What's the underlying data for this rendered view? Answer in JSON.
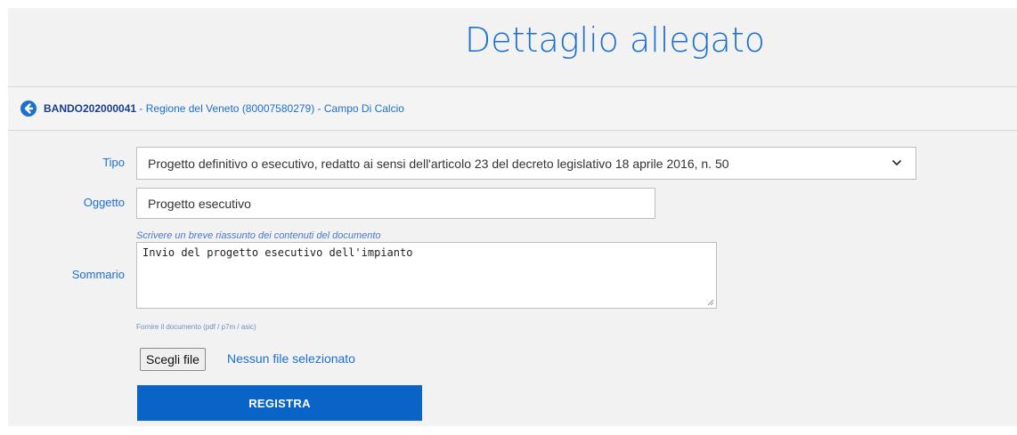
{
  "page": {
    "title": "Dettaglio allegato"
  },
  "breadcrumb": {
    "code": "BANDO202000041",
    "rest": " - Regione del Veneto (80007580279) - Campo Di Calcio"
  },
  "form": {
    "tipo_label": "Tipo",
    "tipo_value": "Progetto definitivo o esecutivo, redatto ai sensi dell'articolo 23 del decreto legislativo 18 aprile 2016, n. 50",
    "oggetto_label": "Oggetto",
    "oggetto_value": "Progetto esecutivo",
    "sommario_hint": "Scrivere un breve riassunto dei contenuti del documento",
    "sommario_label": "Sommario",
    "sommario_value": "Invio del progetto esecutivo dell'impianto",
    "file_note": "Fornire il documento (pdf / p7m / asic)",
    "file_button": "Scegli file",
    "file_status": "Nessun file selezionato",
    "submit_label": "REGISTRA"
  },
  "colors": {
    "accent": "#1b6fd1",
    "button": "#0a64c8"
  }
}
